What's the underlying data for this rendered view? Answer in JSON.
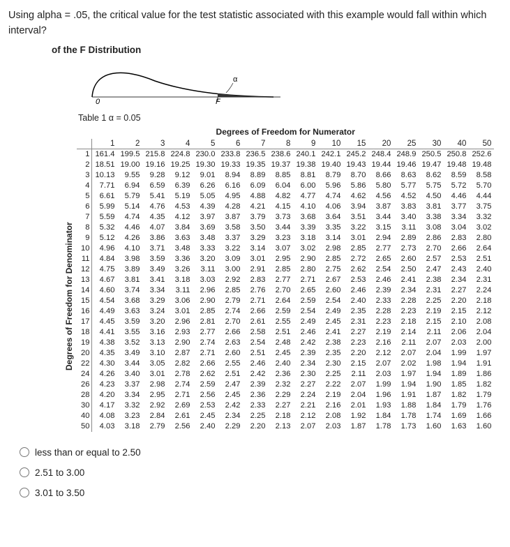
{
  "question": "Using alpha = .05, the critical value for the test statistic associated with this example would fall within which interval?",
  "section_header": "of the F Distribution",
  "curve": {
    "zero": "0",
    "F": "F",
    "alpha": "α"
  },
  "table_caption": "Table 1    α = 0.05",
  "numerator_label": "Degrees of Freedom for Numerator",
  "denominator_label": "Degrees of Freedom for Denominator",
  "col_headers": [
    "1",
    "2",
    "3",
    "4",
    "5",
    "6",
    "7",
    "8",
    "9",
    "10",
    "15",
    "20",
    "25",
    "30",
    "40",
    "50"
  ],
  "row_headers": [
    "1",
    "2",
    "3",
    "4",
    "5",
    "6",
    "7",
    "8",
    "9",
    "10",
    "11",
    "12",
    "13",
    "14",
    "15",
    "16",
    "17",
    "18",
    "19",
    "20",
    "22",
    "24",
    "26",
    "28",
    "30",
    "40",
    "50"
  ],
  "rows": [
    [
      "161.4",
      "199.5",
      "215.8",
      "224.8",
      "230.0",
      "233.8",
      "236.5",
      "238.6",
      "240.1",
      "242.1",
      "245.2",
      "248.4",
      "248.9",
      "250.5",
      "250.8",
      "252.6"
    ],
    [
      "18.51",
      "19.00",
      "19.16",
      "19.25",
      "19.30",
      "19.33",
      "19.35",
      "19.37",
      "19.38",
      "19.40",
      "19.43",
      "19.44",
      "19.46",
      "19.47",
      "19.48",
      "19.48"
    ],
    [
      "10.13",
      "9.55",
      "9.28",
      "9.12",
      "9.01",
      "8.94",
      "8.89",
      "8.85",
      "8.81",
      "8.79",
      "8.70",
      "8.66",
      "8.63",
      "8.62",
      "8.59",
      "8.58"
    ],
    [
      "7.71",
      "6.94",
      "6.59",
      "6.39",
      "6.26",
      "6.16",
      "6.09",
      "6.04",
      "6.00",
      "5.96",
      "5.86",
      "5.80",
      "5.77",
      "5.75",
      "5.72",
      "5.70"
    ],
    [
      "6.61",
      "5.79",
      "5.41",
      "5.19",
      "5.05",
      "4.95",
      "4.88",
      "4.82",
      "4.77",
      "4.74",
      "4.62",
      "4.56",
      "4.52",
      "4.50",
      "4.46",
      "4.44"
    ],
    [
      "5.99",
      "5.14",
      "4.76",
      "4.53",
      "4.39",
      "4.28",
      "4.21",
      "4.15",
      "4.10",
      "4.06",
      "3.94",
      "3.87",
      "3.83",
      "3.81",
      "3.77",
      "3.75"
    ],
    [
      "5.59",
      "4.74",
      "4.35",
      "4.12",
      "3.97",
      "3.87",
      "3.79",
      "3.73",
      "3.68",
      "3.64",
      "3.51",
      "3.44",
      "3.40",
      "3.38",
      "3.34",
      "3.32"
    ],
    [
      "5.32",
      "4.46",
      "4.07",
      "3.84",
      "3.69",
      "3.58",
      "3.50",
      "3.44",
      "3.39",
      "3.35",
      "3.22",
      "3.15",
      "3.11",
      "3.08",
      "3.04",
      "3.02"
    ],
    [
      "5.12",
      "4.26",
      "3.86",
      "3.63",
      "3.48",
      "3.37",
      "3.29",
      "3.23",
      "3.18",
      "3.14",
      "3.01",
      "2.94",
      "2.89",
      "2.86",
      "2.83",
      "2.80"
    ],
    [
      "4.96",
      "4.10",
      "3.71",
      "3.48",
      "3.33",
      "3.22",
      "3.14",
      "3.07",
      "3.02",
      "2.98",
      "2.85",
      "2.77",
      "2.73",
      "2.70",
      "2.66",
      "2.64"
    ],
    [
      "4.84",
      "3.98",
      "3.59",
      "3.36",
      "3.20",
      "3.09",
      "3.01",
      "2.95",
      "2.90",
      "2.85",
      "2.72",
      "2.65",
      "2.60",
      "2.57",
      "2.53",
      "2.51"
    ],
    [
      "4.75",
      "3.89",
      "3.49",
      "3.26",
      "3.11",
      "3.00",
      "2.91",
      "2.85",
      "2.80",
      "2.75",
      "2.62",
      "2.54",
      "2.50",
      "2.47",
      "2.43",
      "2.40"
    ],
    [
      "4.67",
      "3.81",
      "3.41",
      "3.18",
      "3.03",
      "2.92",
      "2.83",
      "2.77",
      "2.71",
      "2.67",
      "2.53",
      "2.46",
      "2.41",
      "2.38",
      "2.34",
      "2.31"
    ],
    [
      "4.60",
      "3.74",
      "3.34",
      "3.11",
      "2.96",
      "2.85",
      "2.76",
      "2.70",
      "2.65",
      "2.60",
      "2.46",
      "2.39",
      "2.34",
      "2.31",
      "2.27",
      "2.24"
    ],
    [
      "4.54",
      "3.68",
      "3.29",
      "3.06",
      "2.90",
      "2.79",
      "2.71",
      "2.64",
      "2.59",
      "2.54",
      "2.40",
      "2.33",
      "2.28",
      "2.25",
      "2.20",
      "2.18"
    ],
    [
      "4.49",
      "3.63",
      "3.24",
      "3.01",
      "2.85",
      "2.74",
      "2.66",
      "2.59",
      "2.54",
      "2.49",
      "2.35",
      "2.28",
      "2.23",
      "2.19",
      "2.15",
      "2.12"
    ],
    [
      "4.45",
      "3.59",
      "3.20",
      "2.96",
      "2.81",
      "2.70",
      "2.61",
      "2.55",
      "2.49",
      "2.45",
      "2.31",
      "2.23",
      "2.18",
      "2.15",
      "2.10",
      "2.08"
    ],
    [
      "4.41",
      "3.55",
      "3.16",
      "2.93",
      "2.77",
      "2.66",
      "2.58",
      "2.51",
      "2.46",
      "2.41",
      "2.27",
      "2.19",
      "2.14",
      "2.11",
      "2.06",
      "2.04"
    ],
    [
      "4.38",
      "3.52",
      "3.13",
      "2.90",
      "2.74",
      "2.63",
      "2.54",
      "2.48",
      "2.42",
      "2.38",
      "2.23",
      "2.16",
      "2.11",
      "2.07",
      "2.03",
      "2.00"
    ],
    [
      "4.35",
      "3.49",
      "3.10",
      "2.87",
      "2.71",
      "2.60",
      "2.51",
      "2.45",
      "2.39",
      "2.35",
      "2.20",
      "2.12",
      "2.07",
      "2.04",
      "1.99",
      "1.97"
    ],
    [
      "4.30",
      "3.44",
      "3.05",
      "2.82",
      "2.66",
      "2.55",
      "2.46",
      "2.40",
      "2.34",
      "2.30",
      "2.15",
      "2.07",
      "2.02",
      "1.98",
      "1.94",
      "1.91"
    ],
    [
      "4.26",
      "3.40",
      "3.01",
      "2.78",
      "2.62",
      "2.51",
      "2.42",
      "2.36",
      "2.30",
      "2.25",
      "2.11",
      "2.03",
      "1.97",
      "1.94",
      "1.89",
      "1.86"
    ],
    [
      "4.23",
      "3.37",
      "2.98",
      "2.74",
      "2.59",
      "2.47",
      "2.39",
      "2.32",
      "2.27",
      "2.22",
      "2.07",
      "1.99",
      "1.94",
      "1.90",
      "1.85",
      "1.82"
    ],
    [
      "4.20",
      "3.34",
      "2.95",
      "2.71",
      "2.56",
      "2.45",
      "2.36",
      "2.29",
      "2.24",
      "2.19",
      "2.04",
      "1.96",
      "1.91",
      "1.87",
      "1.82",
      "1.79"
    ],
    [
      "4.17",
      "3.32",
      "2.92",
      "2.69",
      "2.53",
      "2.42",
      "2.33",
      "2.27",
      "2.21",
      "2.16",
      "2.01",
      "1.93",
      "1.88",
      "1.84",
      "1.79",
      "1.76"
    ],
    [
      "4.08",
      "3.23",
      "2.84",
      "2.61",
      "2.45",
      "2.34",
      "2.25",
      "2.18",
      "2.12",
      "2.08",
      "1.92",
      "1.84",
      "1.78",
      "1.74",
      "1.69",
      "1.66"
    ],
    [
      "4.03",
      "3.18",
      "2.79",
      "2.56",
      "2.40",
      "2.29",
      "2.20",
      "2.13",
      "2.07",
      "2.03",
      "1.87",
      "1.78",
      "1.73",
      "1.60",
      "1.63",
      "1.60"
    ]
  ],
  "choices": [
    "less than or equal to 2.50",
    "2.51 to 3.00",
    "3.01 to 3.50"
  ]
}
